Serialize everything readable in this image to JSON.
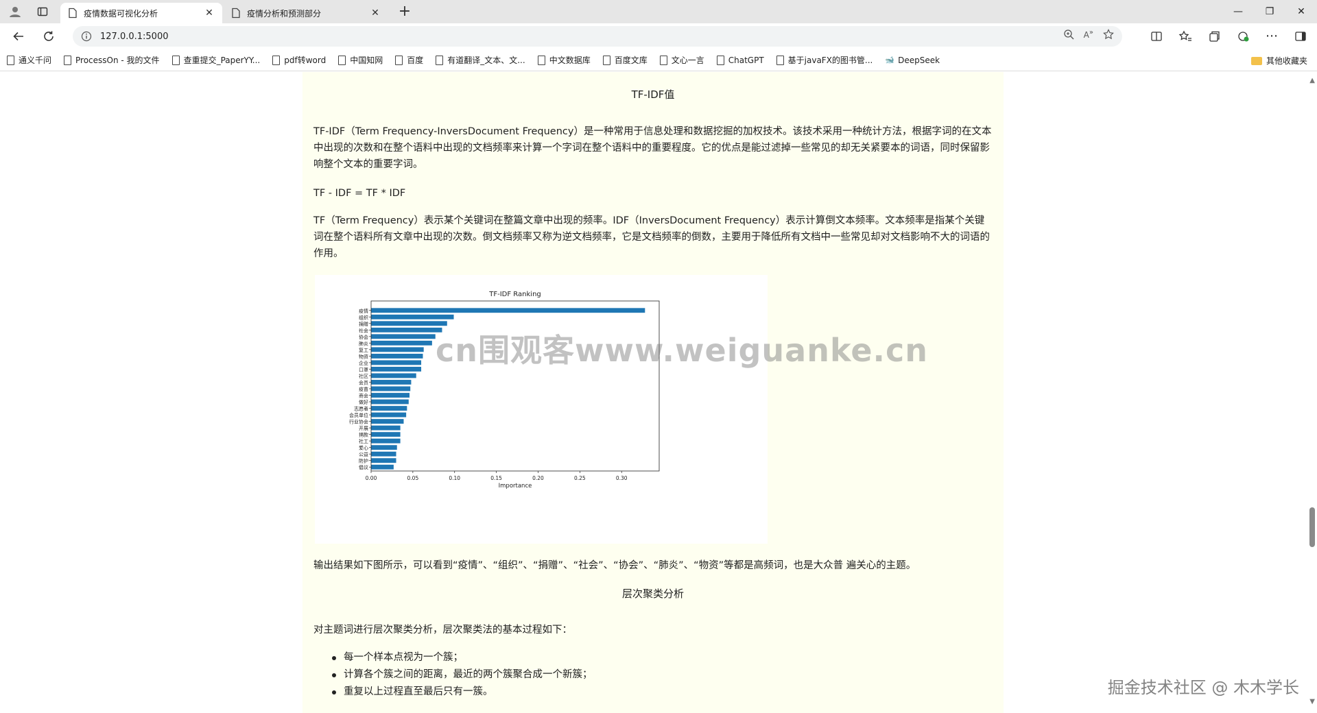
{
  "browser": {
    "tabs": [
      {
        "title": "疫情数据可视化分析",
        "active": true
      },
      {
        "title": "疫情分析和预测部分",
        "active": false
      }
    ],
    "url": "127.0.0.1:5000",
    "bookmarks": [
      "通义千问",
      "ProcessOn - 我的文件",
      "查重提交_PaperYY...",
      "pdf转word",
      "中国知网",
      "百度",
      "有道翻译_文本、文...",
      "中文数据库",
      "百度文库",
      "文心一言",
      "ChatGPT",
      "基于javaFX的图书管...",
      "DeepSeek"
    ],
    "other_bookmarks": "其他收藏夹"
  },
  "page": {
    "tfidf_heading": "TF-IDF值",
    "para1": "TF-IDF（Term Frequency-InversDocument Frequency）是一种常用于信息处理和数据挖掘的加权技术。该技术采用一种统计方法，根据字词的在文本中出现的次数和在整个语料中出现的文档频率来计算一个字词在整个语料中的重要程度。它的优点是能过滤掉一些常见的却无关紧要本的词语，同时保留影响整个文本的重要字词。",
    "formula": "TF - IDF = TF * IDF",
    "para2": "TF（Term Frequency）表示某个关键词在整篇文章中出现的频率。IDF（InversDocument Frequency）表示计算倒文本频率。文本频率是指某个关键词在整个语料所有文章中出现的次数。倒文档频率又称为逆文档频率，它是文档频率的倒数，主要用于降低所有文档中一些常见却对文档影响不大的词语的作用。",
    "result_text": "输出结果如下图所示，可以看到“疫情”、“组织”、“捐赠”、“社会”、“协会”、“肺炎”、“物资”等都是高频词，也是大众普 遍关心的主题。",
    "cluster_heading": "层次聚类分析",
    "cluster_intro": "对主题词进行层次聚类分析，层次聚类法的基本过程如下：",
    "steps": [
      "每一个样本点视为一个簇；",
      "计算各个簇之间的距离，最近的两个簇聚合成一个新簇；",
      "重复以上过程直至最后只有一簇。"
    ]
  },
  "watermarks": {
    "center": "cn围观客www.weiguanke.cn",
    "corner": "掘金技术社区 @ 木木学长"
  },
  "chart_data": {
    "type": "bar",
    "orientation": "horizontal",
    "title": "TF-IDF Ranking",
    "xlabel": "Importance",
    "ylabel": "",
    "xlim": [
      0,
      0.345
    ],
    "xticks": [
      "0.00",
      "0.05",
      "0.10",
      "0.15",
      "0.20",
      "0.25",
      "0.30"
    ],
    "bar_color": "#1f77b4",
    "categories": [
      "疫情",
      "组织",
      "捐赠",
      "社会",
      "协会",
      "肺炎",
      "复工",
      "物资",
      "企业",
      "口罩",
      "社区",
      "会员",
      "疫苗",
      "商会",
      "做好",
      "志愿者",
      "会员单位",
      "行业协会",
      "开展",
      "捐款",
      "社工",
      "爱心",
      "公益",
      "防护",
      "倡议"
    ],
    "values": [
      0.328,
      0.099,
      0.091,
      0.085,
      0.077,
      0.073,
      0.063,
      0.062,
      0.06,
      0.06,
      0.054,
      0.048,
      0.047,
      0.046,
      0.045,
      0.043,
      0.042,
      0.039,
      0.035,
      0.035,
      0.035,
      0.031,
      0.03,
      0.03,
      0.027
    ]
  }
}
